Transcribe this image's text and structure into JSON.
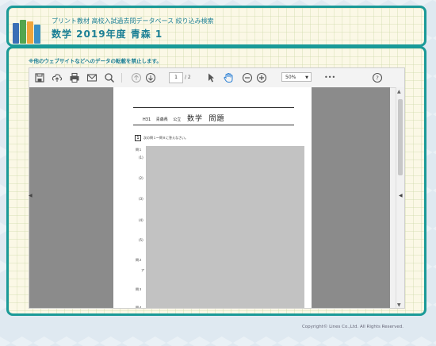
{
  "header": {
    "subtitle": "プリント教材 高校入試過去問データベース 絞り込み検索",
    "title": "数学 2019年度 青森 1"
  },
  "notice": "※他のウェブサイトなどへのデータの転載を禁止します。",
  "viewer": {
    "page_current": "1",
    "page_total": "/ 2",
    "zoom": "50%",
    "zoom_arrow": "▼",
    "more": "•••",
    "help": "?",
    "icons": [
      "save-icon",
      "upload-icon",
      "print-icon",
      "mail-icon",
      "search-icon",
      "up-arrow-icon",
      "down-arrow-icon",
      "pointer-icon",
      "hand-icon",
      "zoom-out-icon",
      "zoom-in-icon",
      "help-icon"
    ]
  },
  "document": {
    "heading_left": "H31",
    "heading_pref": "青森県",
    "heading_type": "公立",
    "heading_subject": "数学",
    "heading_kind": "問題",
    "q1_number": "1",
    "q1_text": "次の問１～問８に答えなさい。",
    "labels": [
      "問１",
      "(1)",
      "(2)",
      "(3)",
      "(4)",
      "(5)",
      "問２",
      "ア",
      "問３",
      "問４"
    ]
  },
  "footer": "Copyright© Lines Co.,Ltd. All Rights Reserved."
}
